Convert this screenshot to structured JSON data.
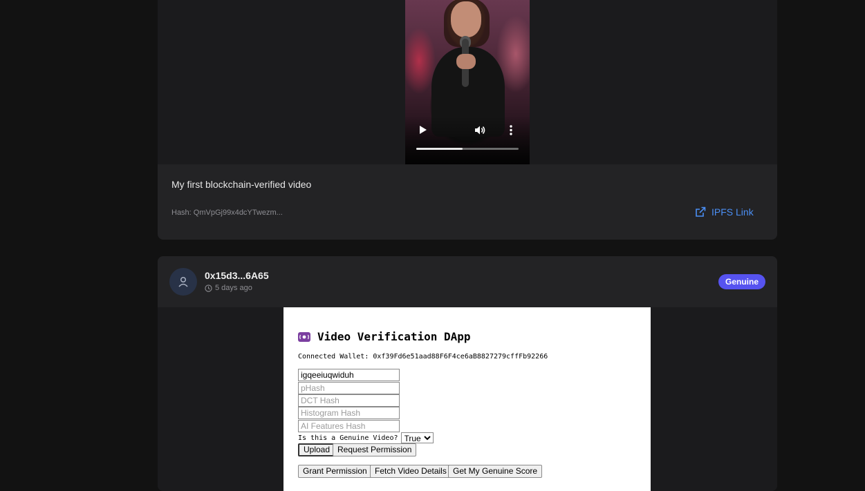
{
  "post1": {
    "caption": "My first blockchain-verified video",
    "hash": "Hash: QmVpGj99x4dcYTwezm...",
    "ipfs_label": "IPFS Link",
    "video": {
      "progress": 0.45
    }
  },
  "post2": {
    "owner": "0x15d3...6A65",
    "time": "5 days ago",
    "badge": "Genuine",
    "badge_color": "#5653f0"
  },
  "dapp": {
    "title": "Video Verification DApp",
    "wallet": "Connected Wallet: 0xf39Fd6e51aad88F6F4ce6aB8827279cffFb92266",
    "title_input_value": "igqeeiuqwiduh",
    "phash_placeholder": "pHash",
    "dct_placeholder": "DCT Hash",
    "histogram_placeholder": "Histogram Hash",
    "ai_placeholder": "AI Features Hash",
    "genuine_question": "Is this a Genuine Video?",
    "genuine_selected": "True",
    "upload_label": "Upload",
    "request_label": "Request Permission",
    "grant_label": "Grant Permission",
    "fetch_label": "Fetch Video Details",
    "score_label": "Get My Genuine Score"
  },
  "colors": {
    "background": "#121212",
    "card": "#232325",
    "link": "#4b8ff5"
  }
}
